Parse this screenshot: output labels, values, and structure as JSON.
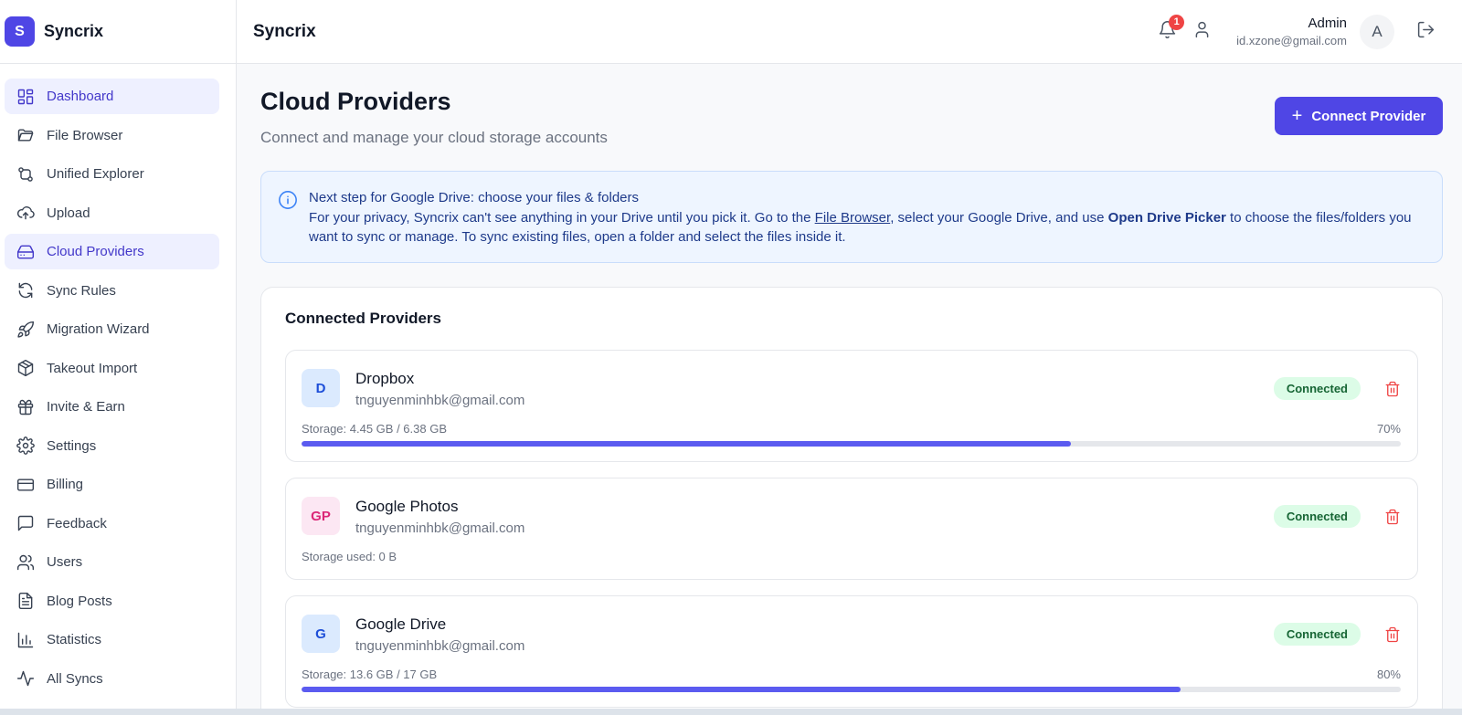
{
  "brand": {
    "logo_letter": "S",
    "name": "Syncrix"
  },
  "sidebar": {
    "items": [
      {
        "label": "Dashboard",
        "icon": "dashboard-icon",
        "active": true
      },
      {
        "label": "File Browser",
        "icon": "folder-open-icon",
        "active": false
      },
      {
        "label": "Unified Explorer",
        "icon": "git-compare-icon",
        "active": false
      },
      {
        "label": "Upload",
        "icon": "cloud-upload-icon",
        "active": false
      },
      {
        "label": "Cloud Providers",
        "icon": "hard-drive-icon",
        "active": true
      },
      {
        "label": "Sync Rules",
        "icon": "refresh-icon",
        "active": false
      },
      {
        "label": "Migration Wizard",
        "icon": "rocket-icon",
        "active": false
      },
      {
        "label": "Takeout Import",
        "icon": "package-icon",
        "active": false
      },
      {
        "label": "Invite & Earn",
        "icon": "gift-icon",
        "active": false
      },
      {
        "label": "Settings",
        "icon": "gear-icon",
        "active": false
      },
      {
        "label": "Billing",
        "icon": "credit-card-icon",
        "active": false
      },
      {
        "label": "Feedback",
        "icon": "message-square-icon",
        "active": false
      },
      {
        "label": "Users",
        "icon": "users-icon",
        "active": false
      },
      {
        "label": "Blog Posts",
        "icon": "file-text-icon",
        "active": false
      },
      {
        "label": "Statistics",
        "icon": "bar-chart-icon",
        "active": false
      },
      {
        "label": "All Syncs",
        "icon": "activity-icon",
        "active": false
      }
    ]
  },
  "header": {
    "title": "Syncrix",
    "notification_count": "1",
    "user": {
      "name": "Admin",
      "email": "id.xzone@gmail.com",
      "avatar_letter": "A"
    }
  },
  "page": {
    "title": "Cloud Providers",
    "subtitle": "Connect and manage your cloud storage accounts",
    "connect_button": "Connect Provider",
    "connect_button_icon": "+"
  },
  "info": {
    "heading": "Next step for Google Drive: choose your files & folders",
    "text_1": "For your privacy, Syncrix can't see anything in your Drive until you pick it. Go to the ",
    "link": "File Browser",
    "text_2": ", select your Google Drive, and use ",
    "bold": "Open Drive Picker",
    "text_3": " to choose the files/folders you want to sync or manage. To sync existing files, open a folder and select the files inside it."
  },
  "providers": {
    "title": "Connected Providers",
    "items": [
      {
        "initials": "D",
        "name": "Dropbox",
        "email": "tnguyenminhbk@gmail.com",
        "status": "Connected",
        "storage_label": "Storage: 4.45 GB / 6.38 GB",
        "percent_label": "70%",
        "usage_fraction": 0.7,
        "icon_bg": "#dbeafe",
        "icon_fg": "#1d4ed8"
      },
      {
        "initials": "GP",
        "name": "Google Photos",
        "email": "tnguyenminhbk@gmail.com",
        "status": "Connected",
        "storage_label": "Storage used: 0 B",
        "icon_bg": "#fce7f3",
        "icon_fg": "#db2777"
      },
      {
        "initials": "G",
        "name": "Google Drive",
        "email": "tnguyenminhbk@gmail.com",
        "status": "Connected",
        "storage_label": "Storage: 13.6 GB / 17 GB",
        "percent_label": "80%",
        "usage_fraction": 0.8,
        "icon_bg": "#dbeafe",
        "icon_fg": "#1d4ed8"
      }
    ]
  },
  "colors": {
    "accent": "#4f46e5",
    "status_bg": "#dcfce7",
    "status_fg": "#166534",
    "danger": "#ef4444"
  }
}
